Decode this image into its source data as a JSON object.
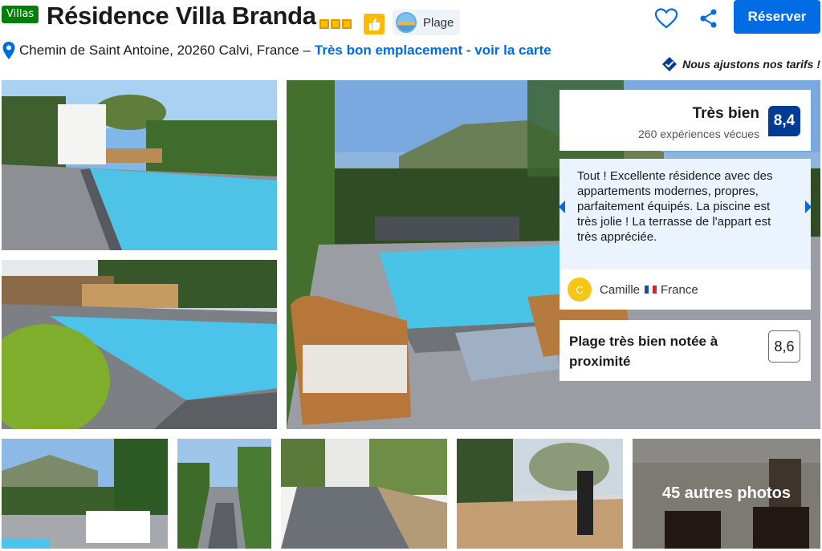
{
  "header": {
    "type_badge": "Villas",
    "title": "Résidence Villa Branda",
    "beach_label": "Plage",
    "reserve_label": "Réserver",
    "address": "Chemin de Saint Antoine, 20260 Calvi, France –",
    "location_link": "Très bon emplacement - voir la carte",
    "price_match": "Nous ajustons nos tarifs !"
  },
  "colors": {
    "accent_blue": "#006ce4",
    "score_blue": "#003b95",
    "villa_green": "#008009",
    "star_yellow": "#febb02"
  },
  "icons": [
    "heart-icon",
    "share-icon",
    "location-pin-icon",
    "thumbs-up-icon",
    "beach-icon",
    "price-match-check-icon",
    "chevron-left-icon",
    "chevron-right-icon"
  ],
  "review_score": {
    "label": "Très bien",
    "count": "260 expériences vécues",
    "score": "8,4"
  },
  "review": {
    "text": "Tout ! Excellente résidence avec des appartements modernes, propres, parfaitement équipés. La piscine est très jolie ! La terrasse de l'appart est très appréciée.",
    "avatar_letter": "C",
    "name": "Camille",
    "country": "France"
  },
  "beach": {
    "text": "Plage très bien notée à proximité",
    "score": "8,6"
  },
  "gallery": {
    "more_label": "45 autres photos"
  }
}
